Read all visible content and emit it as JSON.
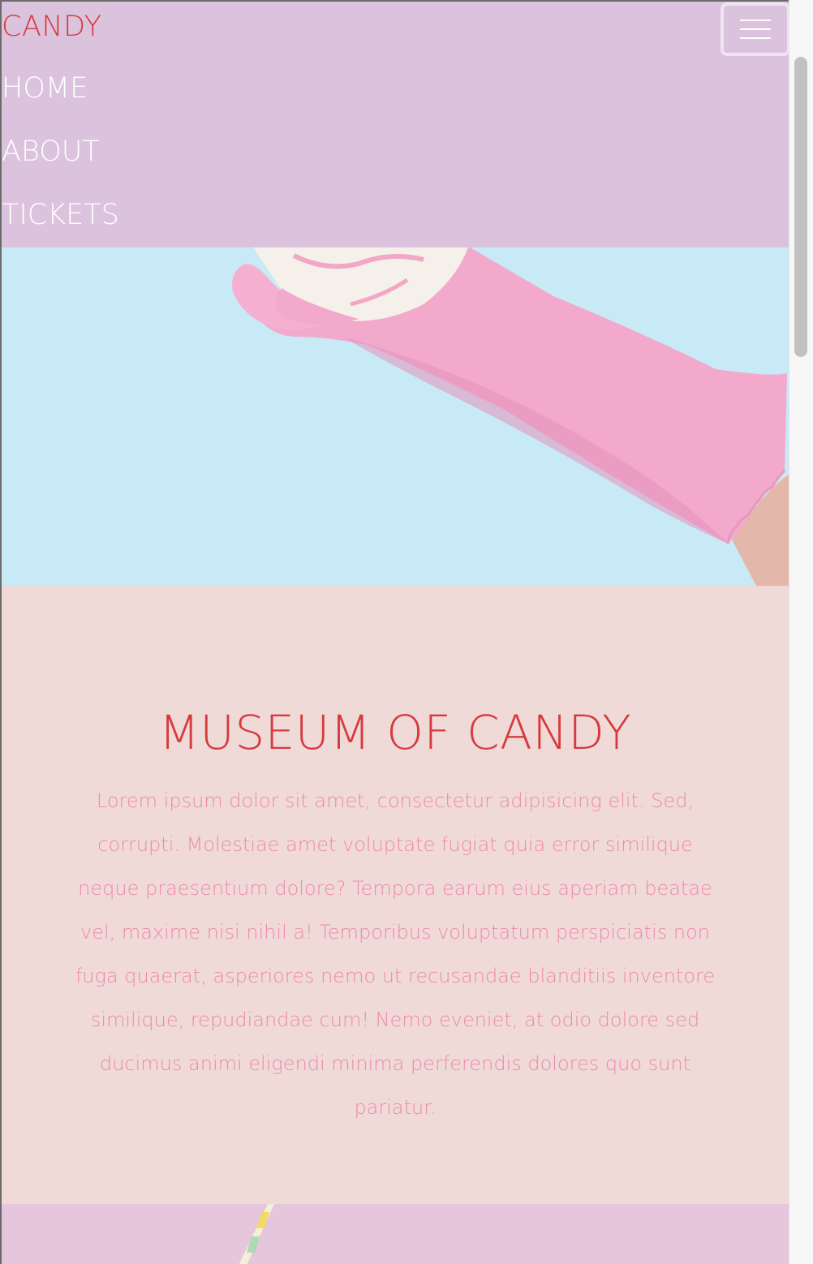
{
  "navbar": {
    "brand": "CANDY",
    "links": [
      "HOME",
      "ABOUT",
      "TICKETS"
    ],
    "toggler_icon": "hamburger-menu-icon"
  },
  "hero": {
    "image": "pink-rubber-glove-holding-candy-on-light-blue-background"
  },
  "about": {
    "title": "MUSEUM OF CANDY",
    "body": "Lorem ipsum dolor sit amet, consectetur adipisicing elit. Sed, corrupti. Molestiae amet voluptate fugiat quia error similique neque praesentium dolore? Tempora earum eius aperiam beatae vel, maxime nisi nihil a! Temporibus voluptatum perspiciatis non fuga quaerat, asperiores nemo ut recusandae blanditiis inventore similique, repudiandae cum! Nemo eveniet, at odio dolore sed ducimus animi eligendi minima perferendis dolores quo sunt pariatur."
  },
  "bottom": {
    "image": "candy-stick-on-pink-background"
  },
  "colors": {
    "navbar_bg": "#dbc3de",
    "brand": "#d63a3d",
    "hero_bg": "#c8e9f6",
    "about_bg": "#f0dad8",
    "about_text": "#ec8aa9",
    "glove": "#f2a9cc"
  }
}
